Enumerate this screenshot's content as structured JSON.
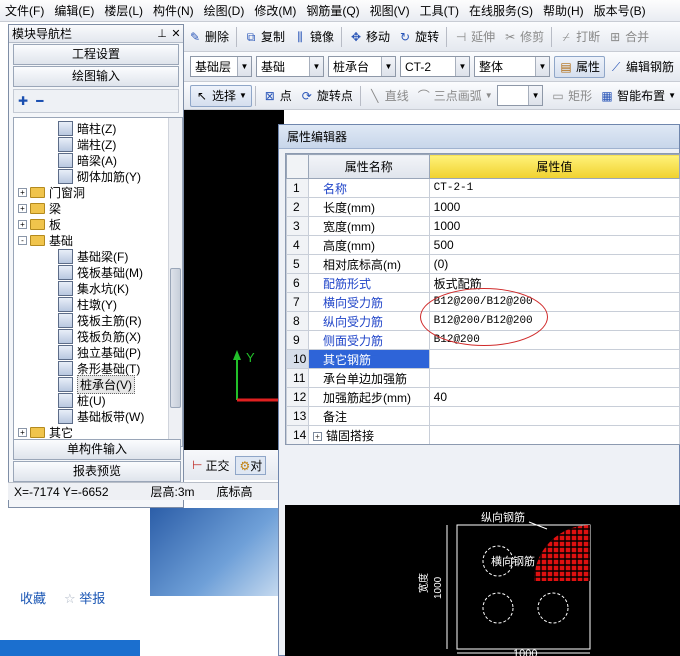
{
  "menu": [
    "文件(F)",
    "编辑(E)",
    "楼层(L)",
    "构件(N)",
    "绘图(D)",
    "修改(M)",
    "钢筋量(Q)",
    "视图(V)",
    "工具(T)",
    "在线服务(S)",
    "帮助(H)",
    "版本号(B)"
  ],
  "toolbar1": [
    "删除",
    "复制",
    "镜像",
    "移动",
    "旋转",
    "延伸",
    "修剪",
    "打断",
    "合并"
  ],
  "toolbar2": {
    "combos": [
      "基础层",
      "基础",
      "桩承台",
      "CT-2",
      "整体"
    ],
    "property_btn": "属性",
    "edit_rebar_btn": "编辑钢筋"
  },
  "toolbar3": [
    "选择",
    "点",
    "旋转点",
    "直线",
    "三点画弧",
    "矩形",
    "智能布置"
  ],
  "left_panel": {
    "title": "模块导航栏",
    "btn_project": "工程设置",
    "btn_draw": "绘图输入",
    "tools_label": "+ -",
    "tree": [
      {
        "label": "暗柱(Z)",
        "type": "item",
        "level": 2
      },
      {
        "label": "端柱(Z)",
        "type": "item",
        "level": 2
      },
      {
        "label": "暗梁(A)",
        "type": "item",
        "level": 2
      },
      {
        "label": "砌体加筋(Y)",
        "type": "item",
        "level": 2
      },
      {
        "label": "门窗洞",
        "type": "folder",
        "level": 1,
        "expand": "+"
      },
      {
        "label": "梁",
        "type": "folder",
        "level": 1,
        "expand": "+"
      },
      {
        "label": "板",
        "type": "folder",
        "level": 1,
        "expand": "+"
      },
      {
        "label": "基础",
        "type": "folder",
        "level": 1,
        "expand": "-"
      },
      {
        "label": "基础梁(F)",
        "type": "item",
        "level": 2
      },
      {
        "label": "筏板基础(M)",
        "type": "item",
        "level": 2
      },
      {
        "label": "集水坑(K)",
        "type": "item",
        "level": 2
      },
      {
        "label": "柱墩(Y)",
        "type": "item",
        "level": 2
      },
      {
        "label": "筏板主筋(R)",
        "type": "item",
        "level": 2
      },
      {
        "label": "筏板负筋(X)",
        "type": "item",
        "level": 2
      },
      {
        "label": "独立基础(P)",
        "type": "item",
        "level": 2
      },
      {
        "label": "条形基础(T)",
        "type": "item",
        "level": 2
      },
      {
        "label": "桩承台(V)",
        "type": "item",
        "level": 2,
        "selected": true
      },
      {
        "label": "桩(U)",
        "type": "item",
        "level": 2
      },
      {
        "label": "基础板带(W)",
        "type": "item",
        "level": 2
      },
      {
        "label": "其它",
        "type": "folder",
        "level": 1,
        "expand": "+"
      }
    ],
    "btn_single": "单构件输入",
    "btn_report": "报表预览"
  },
  "status": {
    "coords": "X=-7174 Y=-6652",
    "floor_height": "层高:3m",
    "bottom_label": "底标高"
  },
  "view_tabs": {
    "ortho": "正交",
    "other": "对"
  },
  "canvas_axis": "Y",
  "dialog": {
    "title": "属性编辑器",
    "col_num": "",
    "col_name": "属性名称",
    "col_value": "属性值",
    "rows": [
      {
        "num": "1",
        "name": "名称",
        "value": "CT-2-1",
        "blue": true
      },
      {
        "num": "2",
        "name": "长度(mm)",
        "value": "1000",
        "blue": false
      },
      {
        "num": "3",
        "name": "宽度(mm)",
        "value": "1000",
        "blue": false
      },
      {
        "num": "4",
        "name": "高度(mm)",
        "value": "500",
        "blue": false
      },
      {
        "num": "5",
        "name": "相对底标高(m)",
        "value": "(0)",
        "blue": false
      },
      {
        "num": "6",
        "name": "配筋形式",
        "value": "板式配筋",
        "blue": true
      },
      {
        "num": "7",
        "name": "横向受力筋",
        "value": "B12@200/B12@200",
        "blue": true
      },
      {
        "num": "8",
        "name": "纵向受力筋",
        "value": "B12@200/B12@200",
        "blue": true
      },
      {
        "num": "9",
        "name": "侧面受力筋",
        "value": "B12@200",
        "blue": true
      },
      {
        "num": "10",
        "name": "其它钢筋",
        "value": "",
        "blue": false,
        "selected": true
      },
      {
        "num": "11",
        "name": "承台单边加强筋",
        "value": "",
        "blue": false
      },
      {
        "num": "12",
        "name": "加强筋起步(mm)",
        "value": "40",
        "blue": false
      },
      {
        "num": "13",
        "name": "备注",
        "value": "",
        "blue": false
      },
      {
        "num": "14",
        "name": "锚固搭接",
        "value": "",
        "blue": false,
        "expandable": true
      }
    ]
  },
  "preview": {
    "label_longitudinal": "纵向钢筋",
    "label_transverse": "横向钢筋",
    "dim_width": "1000",
    "dim_height": "1000",
    "side_label": "宽度"
  },
  "web": {
    "link1": "收藏",
    "link2": "举报"
  },
  "colors": {
    "selection": "#2e64d8",
    "header_value": "#f0d12e",
    "annotation": "#d02a2a",
    "rebar": "#e01010"
  }
}
